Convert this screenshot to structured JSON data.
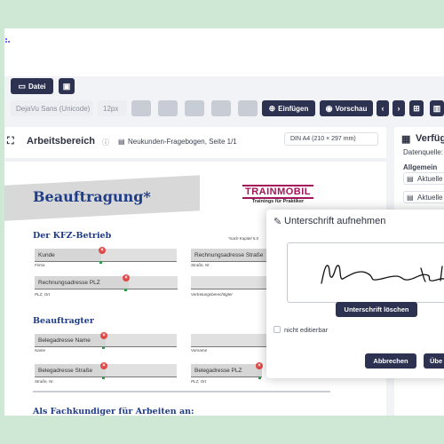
{
  "toolbar": {
    "file_label": "Datei",
    "font_family": "DejaVu Sans (Unicode)",
    "font_size": "12px",
    "insert_label": "Einfügen",
    "preview_label": "Vorschau"
  },
  "workspace": {
    "title": "Arbeitsbereich",
    "document_title": "Neukunden-Fragebogen, Seite 1/1",
    "page_format": "DIN A4 (210 × 297 mm)"
  },
  "sidebar": {
    "title": "Verfüg",
    "data_source_label": "Datenquelle:",
    "group_label": "Allgemein",
    "items": [
      "Aktuelle",
      "Aktuelle"
    ]
  },
  "document": {
    "banner_title": "Beauftragung*",
    "logo_name": "TRAINMOBIL",
    "logo_tagline": "Trainings für Praktiker",
    "footnote": "*nach Kapitel 5.0",
    "section1_title": "Der KFZ-Betrieb",
    "section2_title": "Beauftragter",
    "section3_title": "Als Fachkundiger für Arbeiten an:",
    "fields": {
      "kunde": "Kunde",
      "billing_street": "Rechnungsadresse Straße",
      "billing_zip": "Rechnungsadresse PLZ",
      "assignee_name": "Belegadresse Name",
      "assignee_street": "Belegadresse Straße",
      "assignee_zip": "Belegadresse PLZ"
    },
    "labels": {
      "firma": "Firma",
      "street_no": "Straße, Nr.",
      "zip_city": "PLZ, Ort",
      "representative": "Vertretungsberechtigter",
      "name": "Name",
      "first_name": "Vorname",
      "street_no2": "Straße, Nr.",
      "zip_city2": "PLZ, Ort"
    }
  },
  "signature_dialog": {
    "title": "Unterschrift aufnehmen",
    "clear_label": "Unterschrift löschen",
    "not_editable_label": "nicht editierbar",
    "cancel_label": "Abbrechen",
    "confirm_label": "Übe"
  },
  "colors": {
    "accent_dark": "#2d3250",
    "brand_blue": "#1f3c87",
    "brand_magenta": "#a3145b",
    "delete_badge": "#e04848",
    "handle_green": "#2a9d4b"
  }
}
